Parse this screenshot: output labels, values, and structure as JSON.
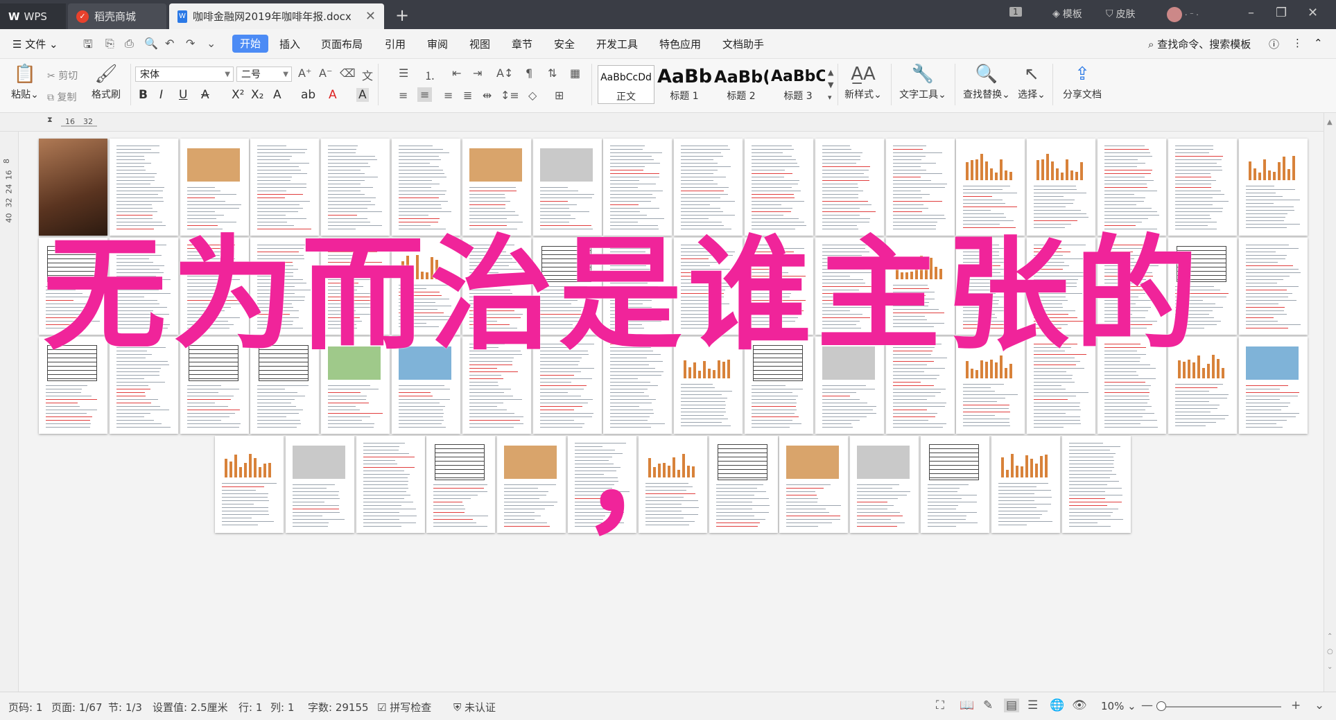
{
  "titlebar": {
    "tabs": [
      {
        "label": "WPS",
        "icon": "wps-logo-icon"
      },
      {
        "label": "稻壳商城",
        "icon": "daoke-logo-icon"
      },
      {
        "label": "咖啡金融网2019年咖啡年报.docx",
        "icon": "word-doc-icon"
      }
    ],
    "page_badge": "1",
    "template_label": "模板",
    "skin_label": "皮肤"
  },
  "menubar": {
    "file_label": "文件",
    "start_label": "开始",
    "items": [
      "插入",
      "页面布局",
      "引用",
      "审阅",
      "视图",
      "章节",
      "安全",
      "开发工具",
      "特色应用",
      "文档助手"
    ],
    "search_label": "查找命令、搜索模板"
  },
  "ribbon": {
    "paste_label": "粘贴",
    "cut_label": "剪切",
    "copy_label": "复制",
    "format_painter_label": "格式刷",
    "font_name": "宋体",
    "font_size": "二号",
    "styles": [
      {
        "preview": "AaBbCcDd",
        "label": "正文"
      },
      {
        "preview": "AaBb",
        "label": "标题 1"
      },
      {
        "preview": "AaBb(",
        "label": "标题 2"
      },
      {
        "preview": "AaBbC",
        "label": "标题 3"
      }
    ],
    "new_style_label": "新样式",
    "text_tools_label": "文字工具",
    "find_replace_label": "查找替换",
    "select_label": "选择",
    "share_label": "分享文档"
  },
  "ruler": {
    "top": [
      "16",
      "32"
    ],
    "left": [
      "8",
      "16",
      "24",
      "32",
      "40"
    ]
  },
  "overlay": {
    "title": "无为而治是谁主张的",
    "comma": "，"
  },
  "statusbar": {
    "page_no": "页码: 1",
    "page_count": "页面: 1/67",
    "section": "节: 1/3",
    "setting": "设置值: 2.5厘米",
    "row": "行: 1",
    "col": "列: 1",
    "word_count": "字数: 29155",
    "spell_check": "拼写检查",
    "cert": "未认证",
    "zoom": "10%"
  },
  "colors": {
    "accent": "#4c8bf5",
    "overlay": "#f0249a",
    "titlebar": "#3a3d45"
  }
}
